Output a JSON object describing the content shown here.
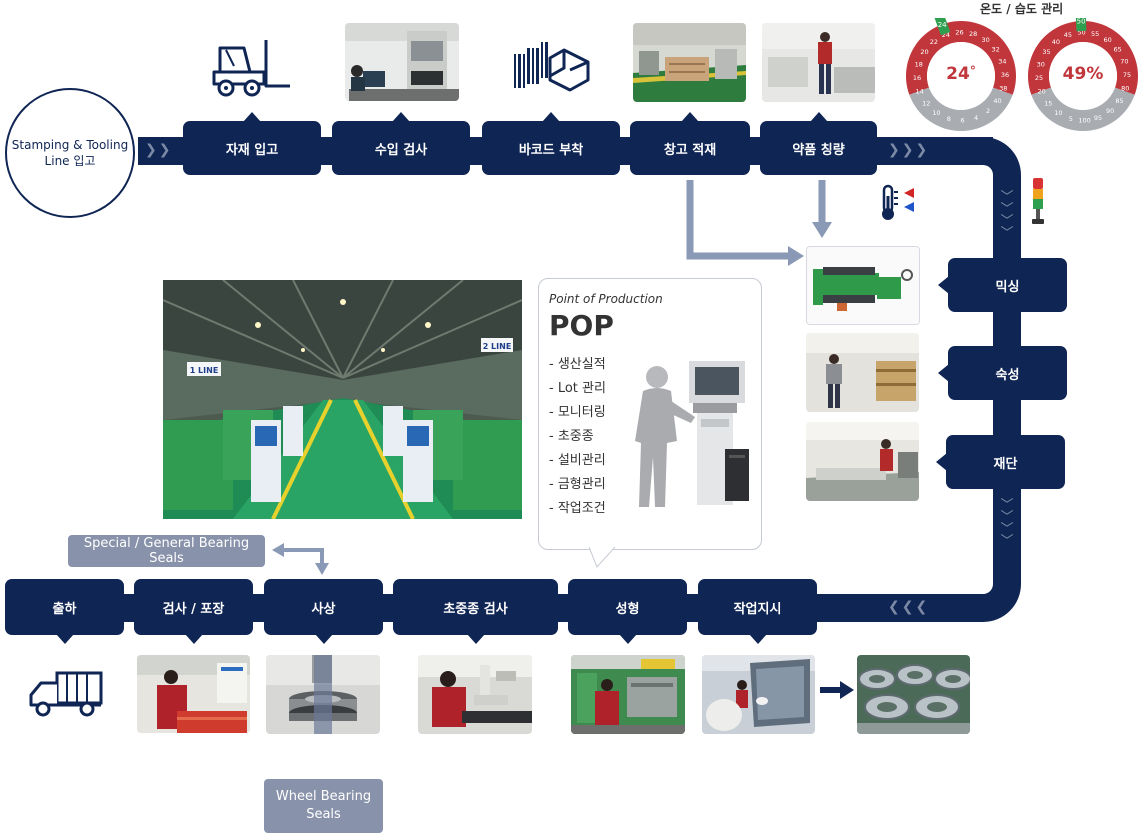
{
  "start": {
    "label_line1": "Stamping & Tooling",
    "label_line2": "Line 입고"
  },
  "top_steps": [
    "자재 입고",
    "수입 검사",
    "바코드 부착",
    "창고 적재",
    "약품 칭량"
  ],
  "right_steps": [
    "믹싱",
    "숙성",
    "재단"
  ],
  "bottom_steps": [
    "출하",
    "검사 / 포장",
    "사상",
    "초중종 검사",
    "성형",
    "작업지시"
  ],
  "monitor": {
    "title": "온도 / 습도 관리",
    "temperature": {
      "value": "24",
      "unit": "°",
      "scale": [
        "14",
        "16",
        "18",
        "20",
        "22",
        "24",
        "26",
        "28",
        "30",
        "32",
        "34",
        "36",
        "38",
        "40",
        "2",
        "4",
        "6",
        "8",
        "10",
        "12"
      ]
    },
    "humidity": {
      "value": "49",
      "unit": "%",
      "scale": [
        "20",
        "25",
        "30",
        "35",
        "40",
        "45",
        "50",
        "55",
        "60",
        "65",
        "70",
        "75",
        "80",
        "85",
        "90",
        "95",
        "100",
        "5",
        "10",
        "15"
      ]
    }
  },
  "pop": {
    "subtitle": "Point of Production",
    "title": "POP",
    "items": [
      "- 생산실적",
      "- Lot 관리",
      "- 모니터링",
      "- 초중종",
      "- 설비관리",
      "- 금형관리",
      "- 작업조건"
    ]
  },
  "seal_types": {
    "special": "Special / General Bearing Seals",
    "wheel_line1": "Wheel Bearing",
    "wheel_line2": "Seals"
  },
  "factory_signs": [
    "1 LINE",
    "2 LINE"
  ],
  "colors": {
    "navy": "#0f2554",
    "gray_box": "#8892aa",
    "gauge_red": "#c0363b",
    "gauge_green": "#2e9e4f",
    "arrow_gray": "#8a99b5"
  }
}
